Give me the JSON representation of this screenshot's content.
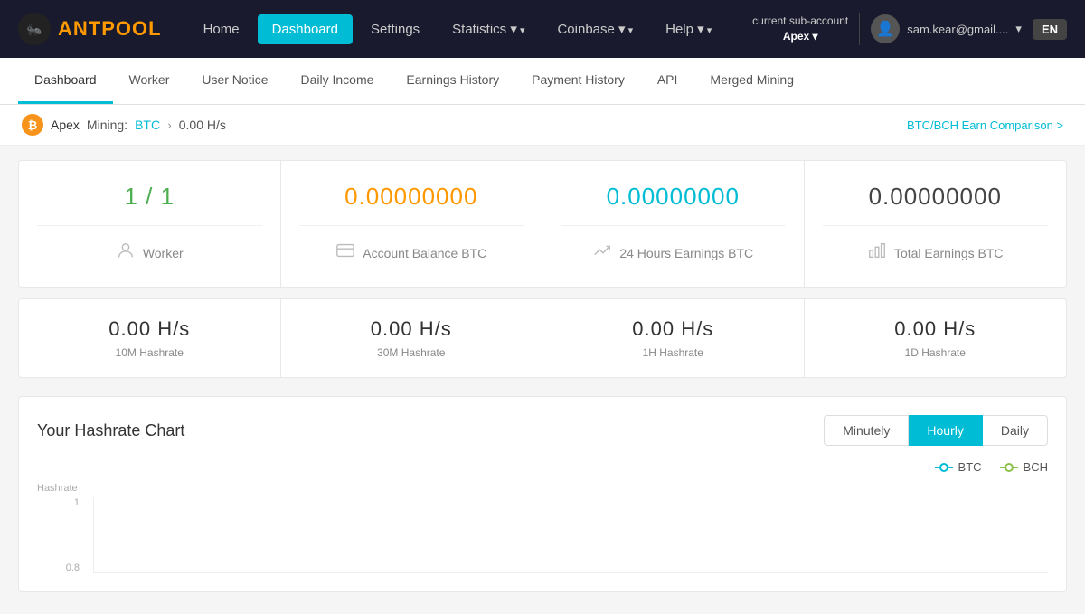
{
  "nav": {
    "logo_ant": "ANT",
    "logo_pool": "POOL",
    "links": [
      {
        "label": "Home",
        "active": false
      },
      {
        "label": "Dashboard",
        "active": true
      },
      {
        "label": "Settings",
        "active": false
      },
      {
        "label": "Statistics",
        "active": false,
        "dropdown": true
      },
      {
        "label": "Coinbase",
        "active": false,
        "dropdown": true
      },
      {
        "label": "Help",
        "active": false,
        "dropdown": true
      }
    ],
    "sub_account_prefix": "current sub-account",
    "account_name": "Apex",
    "user_email": "sam.kear@gmail....",
    "lang": "EN"
  },
  "sub_tabs": [
    {
      "label": "Dashboard",
      "active": true
    },
    {
      "label": "Worker",
      "active": false
    },
    {
      "label": "User Notice",
      "active": false
    },
    {
      "label": "Daily Income",
      "active": false
    },
    {
      "label": "Earnings History",
      "active": false
    },
    {
      "label": "Payment History",
      "active": false
    },
    {
      "label": "API",
      "active": false
    },
    {
      "label": "Merged Mining",
      "active": false
    }
  ],
  "breadcrumb": {
    "account": "Apex",
    "mining_label": "Mining:",
    "mining_coin": "BTC",
    "hashrate": "0.00 H/s",
    "comparison_link": "BTC/BCH Earn Comparison >"
  },
  "stat_cards": [
    {
      "value": "1 / 1",
      "color": "green",
      "label": "Worker",
      "icon": "👤"
    },
    {
      "value": "0.00000000",
      "color": "orange",
      "label": "Account Balance BTC",
      "icon": "💳"
    },
    {
      "value": "0.00000000",
      "color": "teal",
      "label": "24 Hours Earnings BTC",
      "icon": "📈"
    },
    {
      "value": "0.00000000",
      "color": "dark",
      "label": "Total Earnings BTC",
      "icon": "📊"
    }
  ],
  "hashrate_cards": [
    {
      "value": "0.00 H/s",
      "label": "10M Hashrate"
    },
    {
      "value": "0.00 H/s",
      "label": "30M Hashrate"
    },
    {
      "value": "0.00 H/s",
      "label": "1H Hashrate"
    },
    {
      "value": "0.00 H/s",
      "label": "1D Hashrate"
    }
  ],
  "chart": {
    "title": "Your Hashrate Chart",
    "controls": [
      "Minutely",
      "Hourly",
      "Daily"
    ],
    "active_control": "Hourly",
    "legend": [
      {
        "label": "BTC",
        "color": "#00bcd4"
      },
      {
        "label": "BCH",
        "color": "#8bc34a"
      }
    ],
    "y_axis_label": "Hashrate",
    "y_ticks": [
      "1",
      "0.8"
    ]
  }
}
